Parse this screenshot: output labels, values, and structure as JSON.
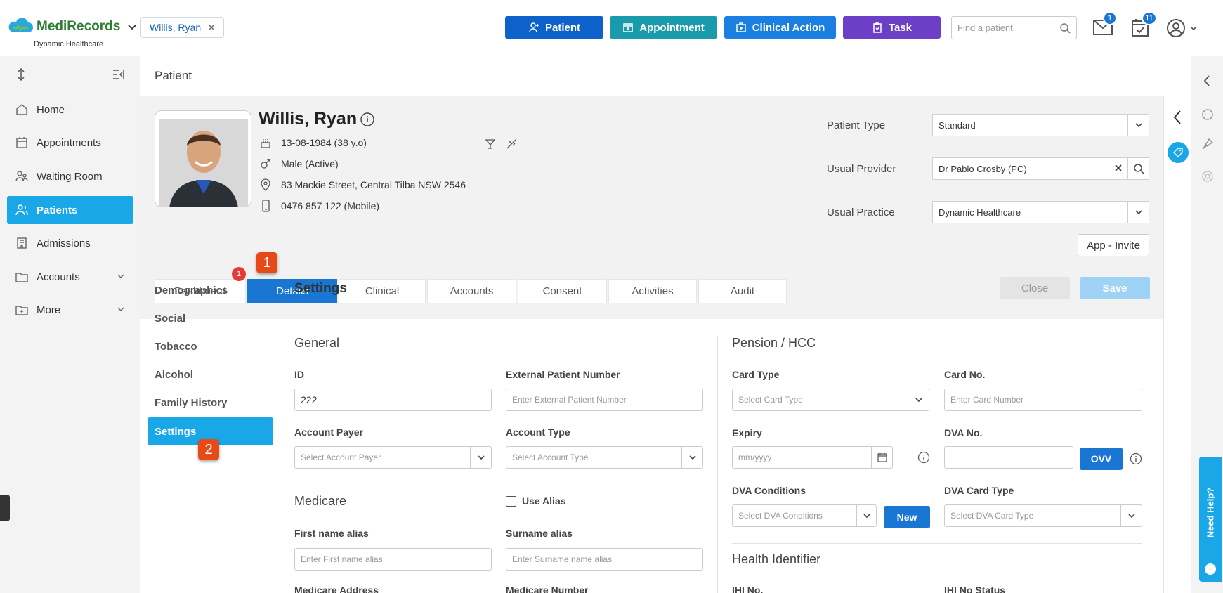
{
  "brand": {
    "name": "MediRecords",
    "practice": "Dynamic Healthcare",
    "accent": "#1976d2"
  },
  "open_patient_chip": "Willis, Ryan",
  "quick_actions": [
    {
      "label": "Patient",
      "color": "#0d62c9"
    },
    {
      "label": "Appointment",
      "color": "#1a9bab"
    },
    {
      "label": "Clinical Action",
      "color": "#1a7fe0"
    },
    {
      "label": "Task",
      "color": "#6c3fc6"
    }
  ],
  "search": {
    "placeholder": "Find a patient"
  },
  "notifications": {
    "mail_count": "1",
    "tasks_count": "11"
  },
  "sidebar": {
    "items": [
      {
        "label": "Home",
        "icon": "home-icon"
      },
      {
        "label": "Appointments",
        "icon": "calendar-icon"
      },
      {
        "label": "Waiting Room",
        "icon": "waiting-room-icon"
      },
      {
        "label": "Patients",
        "icon": "patients-icon",
        "active": true
      },
      {
        "label": "Admissions",
        "icon": "admissions-icon"
      },
      {
        "label": "Accounts",
        "icon": "folder-icon"
      },
      {
        "label": "More",
        "icon": "more-folder-icon"
      }
    ]
  },
  "page": {
    "title": "Patient"
  },
  "patient": {
    "name": "Willis, Ryan",
    "dob": "13-08-1984 (38 y.o)",
    "gender": "Male (Active)",
    "address": "83 Mackie Street, Central Tilba NSW 2546",
    "phone": "0476 857 122 (Mobile)"
  },
  "patient_meta": {
    "type_label": "Patient Type",
    "type_value": "Standard",
    "provider_label": "Usual Provider",
    "provider_value": "Dr Pablo Crosby (PC)",
    "practice_label": "Usual Practice",
    "practice_value": "Dynamic Healthcare",
    "invite_button": "App - Invite"
  },
  "tabs": [
    "Dashboard",
    "Details",
    "Clinical",
    "Accounts",
    "Consent",
    "Activities",
    "Audit"
  ],
  "dashboard_badge": "1",
  "subnav": [
    "Demographics",
    "Social",
    "Tobacco",
    "Alcohol",
    "Family History",
    "Settings"
  ],
  "settings": {
    "title": "Settings",
    "close_label": "Close",
    "save_label": "Save",
    "general": {
      "title": "General",
      "id_label": "ID",
      "id_value": "222",
      "ext_label": "External Patient Number",
      "ext_placeholder": "Enter External Patient Number",
      "payer_label": "Account Payer",
      "payer_placeholder": "Select Account Payer",
      "acctype_label": "Account Type",
      "acctype_placeholder": "Select Account Type"
    },
    "medicare": {
      "title": "Medicare",
      "use_alias": "Use Alias",
      "first_label": "First name alias",
      "first_placeholder": "Enter First name alias",
      "surname_label": "Surname alias",
      "surname_placeholder": "Enter Surname name alias",
      "address_label": "Medicare Address",
      "number_label": "Medicare Number"
    },
    "pension": {
      "title": "Pension / HCC",
      "card_type_label": "Card Type",
      "card_type_placeholder": "Select Card Type",
      "card_no_label": "Card No.",
      "card_no_placeholder": "Enter Card Number",
      "expiry_label": "Expiry",
      "expiry_placeholder": "mm/yyyy",
      "dva_no_label": "DVA No.",
      "ovv_button": "OVV",
      "dva_cond_label": "DVA Conditions",
      "dva_cond_placeholder": "Select DVA Conditions",
      "new_button": "New",
      "dva_card_label": "DVA Card Type",
      "dva_card_placeholder": "Select DVA Card Type"
    },
    "health_identifier": {
      "title": "Health Identifier",
      "ihi_label": "IHI No.",
      "ihi_status_label": "IHI No Status"
    }
  },
  "annotations": [
    "1",
    "2"
  ],
  "help_tab": "Need Help?"
}
